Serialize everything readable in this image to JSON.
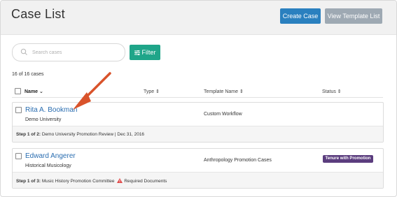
{
  "header": {
    "title": "Case List",
    "create_label": "Create Case",
    "view_template_label": "View Template List"
  },
  "search": {
    "placeholder": "Search cases",
    "icon": "search-icon"
  },
  "filter": {
    "label": "Filter",
    "icon": "filter-icon"
  },
  "result_count": "16 of 16 cases",
  "columns": {
    "name": "Name ⌄",
    "type": "Type ⇕",
    "template": "Template Name ⇕",
    "status": "Status ⇕"
  },
  "cases": [
    {
      "name": "Rita A. Bookman",
      "unit": "Demo University",
      "template": "Custom Workflow",
      "status": "",
      "step_label": "Step 1 of 2:",
      "step_detail": "Demo University Promotion Review | Dec 31, 2016",
      "warning": ""
    },
    {
      "name": "Edward Angerer",
      "unit": "Historical Musicology",
      "template": "Anthropology Promotion Cases",
      "status": "Tenure with Promotion",
      "step_label": "Step 1 of 3:",
      "step_detail": "Music History Promotion Committee",
      "warning": "Required Documents"
    }
  ],
  "colors": {
    "primary": "#2a80bf",
    "secondary": "#9ea9b3",
    "filter": "#1fa589",
    "badge": "#5b3d7e",
    "annotation_arrow": "#d9532b",
    "warning": "#e04848"
  }
}
